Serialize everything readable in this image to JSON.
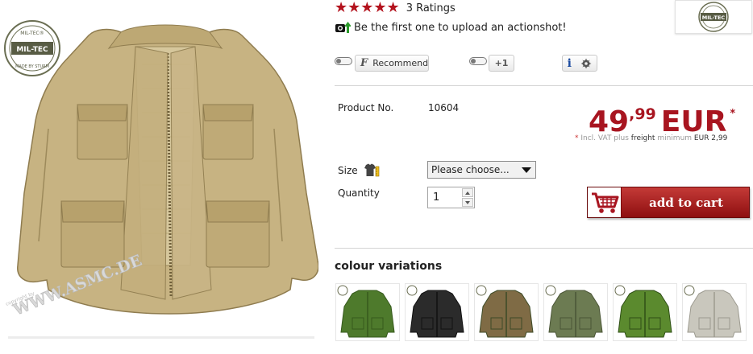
{
  "product_image": {
    "alt": "M65 field jacket in khaki",
    "logo_top": "MIL-TEC",
    "logo_bottom": "MADE BY STURM",
    "watermark": "copyright by WWW.ASMC.DE"
  },
  "ratings": {
    "stars": 5,
    "star_glyphs": "★★★★★",
    "text": "3 Ratings"
  },
  "actionshot": {
    "icon": "camera-upload-icon",
    "text": "Be the first one to upload an actionshot!"
  },
  "brand_logo": {
    "text": "MIL-TEC"
  },
  "social": {
    "facebook_label": "Recommend",
    "facebook_glyph": "F",
    "gplus_label": "+1",
    "info_glyph": "i"
  },
  "product": {
    "number_label": "Product No.",
    "number_value": "10604",
    "price_int": "49",
    "price_sep": ",",
    "price_dec": "99",
    "currency": "EUR",
    "price_asterisk": "*",
    "vat_asterisk": "*",
    "vat_text_1": "Incl. VAT plus",
    "vat_freight": "freight",
    "vat_minimum": "minimum",
    "vat_amount": "EUR 2,99"
  },
  "form": {
    "size_label": "Size",
    "size_selected": "Please choose...",
    "quantity_label": "Quantity",
    "quantity_value": "1",
    "add_to_cart": "add to cart"
  },
  "variations": {
    "title": "colour variations",
    "items": [
      {
        "name": "olive",
        "color": "#4e7a2c",
        "shade": "#36591c"
      },
      {
        "name": "black",
        "color": "#2b2b2b",
        "shade": "#111111"
      },
      {
        "name": "woodland camo",
        "color": "#7f6b45",
        "shade": "#3c4a26"
      },
      {
        "name": "flecktarn camo",
        "color": "#6c7b52",
        "shade": "#4a5536"
      },
      {
        "name": "green camo",
        "color": "#5b8a2e",
        "shade": "#2f4f16"
      },
      {
        "name": "ACU digital",
        "color": "#c9c7bd",
        "shade": "#9c9a8f"
      }
    ]
  },
  "colors": {
    "accent_red": "#a81520",
    "button_red_top": "#c43a37",
    "button_red_bottom": "#8e0f10",
    "jacket_khaki": "#c4b07e"
  }
}
